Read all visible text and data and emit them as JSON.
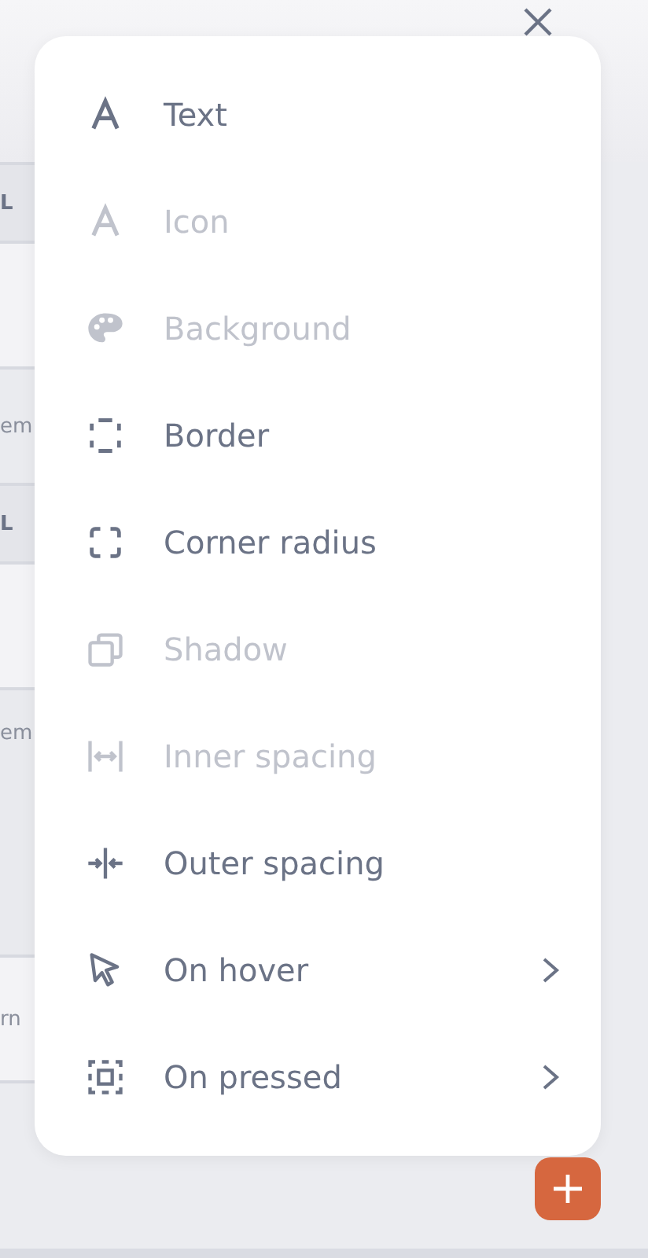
{
  "backdrop": {
    "rows": [
      {
        "kind": "header",
        "text": "L"
      },
      {
        "kind": "blank"
      },
      {
        "kind": "body",
        "text": "em"
      },
      {
        "kind": "header",
        "text": "L"
      },
      {
        "kind": "blank"
      },
      {
        "kind": "tall",
        "text": "em"
      },
      {
        "kind": "field",
        "text": "rn"
      }
    ]
  },
  "menu": {
    "items": [
      {
        "label": "Text",
        "disabled": false,
        "submenu": false
      },
      {
        "label": "Icon",
        "disabled": true,
        "submenu": false
      },
      {
        "label": "Background",
        "disabled": true,
        "submenu": false
      },
      {
        "label": "Border",
        "disabled": false,
        "submenu": false
      },
      {
        "label": "Corner radius",
        "disabled": false,
        "submenu": false
      },
      {
        "label": "Shadow",
        "disabled": true,
        "submenu": false
      },
      {
        "label": "Inner spacing",
        "disabled": true,
        "submenu": false
      },
      {
        "label": "Outer spacing",
        "disabled": false,
        "submenu": false
      },
      {
        "label": "On hover",
        "disabled": false,
        "submenu": true
      },
      {
        "label": "On pressed",
        "disabled": false,
        "submenu": true
      }
    ]
  }
}
